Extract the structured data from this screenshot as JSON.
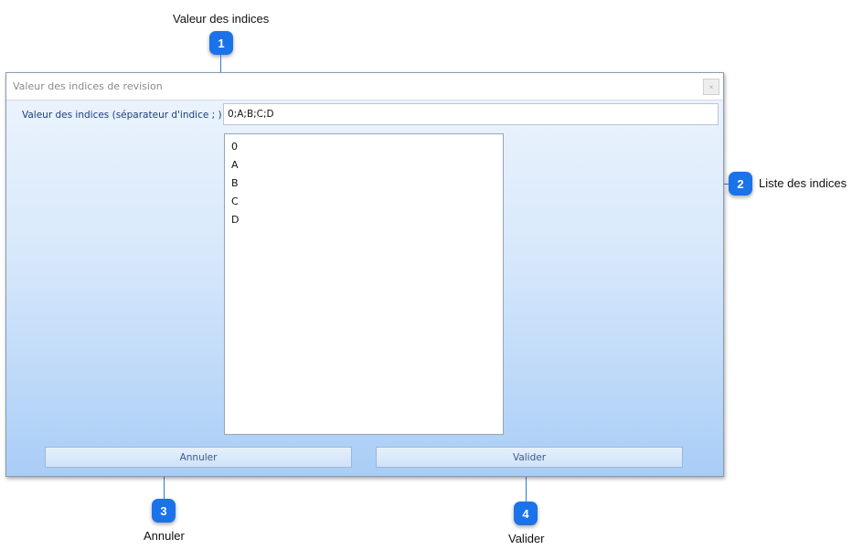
{
  "callouts": [
    {
      "number": "1",
      "label": "Valeur des indices"
    },
    {
      "number": "2",
      "label": "Liste des indices"
    },
    {
      "number": "3",
      "label": "Annuler"
    },
    {
      "number": "4",
      "label": "Valider"
    }
  ],
  "dialog": {
    "title": "Valeur des indices de revision",
    "close_icon": "×",
    "field_label": "Valeur des indices (séparateur d'indice ; )",
    "field_value": "0;A;B;C;D",
    "list_items": [
      "0",
      "A",
      "B",
      "C",
      "D"
    ],
    "cancel_label": "Annuler",
    "validate_label": "Valider"
  },
  "colors": {
    "badge": "#1a73e8",
    "callout_line": "#2a7bd8",
    "dialog_gradient_top": "#eef5fd",
    "dialog_gradient_bottom": "#a9cdf6"
  }
}
